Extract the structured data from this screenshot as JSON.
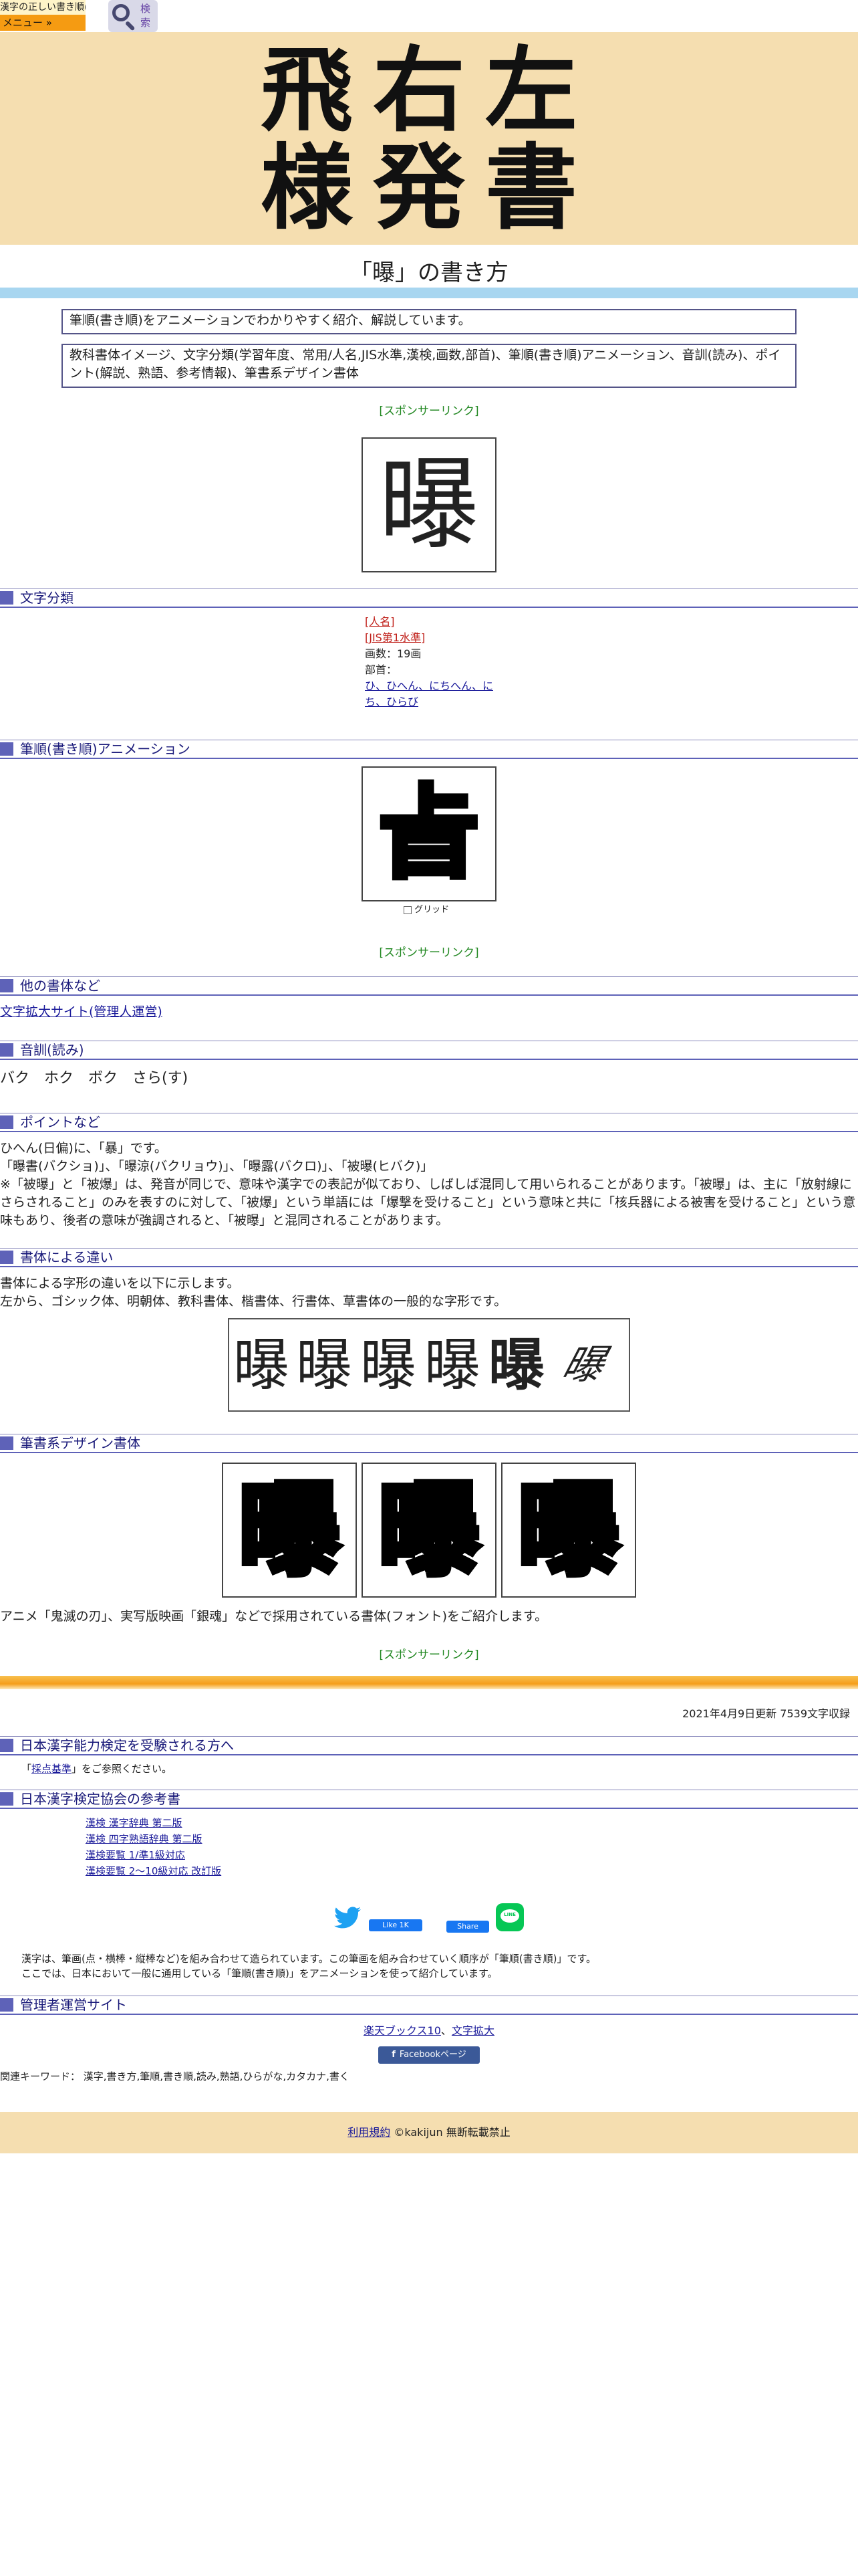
{
  "nav": {
    "logo_text": "漢字の正しい書き順(筆順)",
    "menu_label": "メニュー »",
    "search_label": "検索"
  },
  "banner": {
    "line1": "飛右左",
    "line2": "様発書"
  },
  "page_title": "「曝」の書き方",
  "intro": {
    "summary": "筆順(書き順)をアニメーションでわかりやすく紹介、解説しています。",
    "contents": "教科書体イメージ、文字分類(学習年度、常用/人名,JIS水準,漢検,画数,部首)、筆順(書き順)アニメーション、音訓(読み)、ポイント(解説、熟語、参考情報)、筆書系デザイン書体"
  },
  "sponsor_link": "[スポンサーリンク]",
  "kanji": "曝",
  "classification": {
    "heading": "文字分類",
    "jinmei": "[人名]",
    "jis": "[JIS第1水準]",
    "strokes": "画数：19画",
    "radical_label": "部首：",
    "radical": "ひ、ひへん、にちへん、にち、ひらび"
  },
  "animation": {
    "heading": "筆順(書き順)アニメーション",
    "frame_char": "㫖",
    "grid_label": "グリッド"
  },
  "other_fonts": {
    "heading": "他の書体など",
    "link": "文字拡大サイト(管理人運営)"
  },
  "readings": {
    "heading": "音訓(読み)",
    "text": "バク　ホク　ボク　さら(す)"
  },
  "points": {
    "heading": "ポイントなど",
    "line1": "ひへん(日偏)に、「暴」です。",
    "line2": "「曝書(バクショ)」、「曝涼(バクリョウ)」、「曝露(バクロ)」、「被曝(ヒバク)」",
    "line3": "※「被曝」と「被爆」は、発音が同じで、意味や漢字での表記が似ており、しばしば混同して用いられることがあります。「被曝」は、主に「放射線にさらされること」のみを表すのに対して、「被爆」という単語には「爆撃を受けること」という意味と共に「核兵器による被害を受けること」という意味もあり、後者の意味が強調されると、「被曝」と混同されることがあります。"
  },
  "font_diff": {
    "heading": "書体による違い",
    "line1": "書体による字形の違いを以下に示します。",
    "line2": "左から、ゴシック体、明朝体、教科書体、楷書体、行書体、草書体の一般的な字形です。",
    "samples": [
      "曝",
      "曝",
      "曝",
      "曝",
      "曝",
      "曝"
    ]
  },
  "design_fonts": {
    "heading": "筆書系デザイン書体",
    "chars": [
      "曝",
      "曝",
      "曝"
    ],
    "note": "アニメ「鬼滅の刃」、実写版映画「銀魂」などで採用されている書体(フォント)をご紹介します。"
  },
  "updated": "2021年4月9日更新 7539文字収録",
  "kentei": {
    "heading": "日本漢字能力検定を受験される方へ",
    "note_pre": "「",
    "note_link": "採点基準",
    "note_post": "」をご参照ください。"
  },
  "references": {
    "heading": "日本漢字検定協会の参考書",
    "items": [
      "漢検 漢字辞典 第二版",
      "漢検 四字熟語辞典 第二版",
      "漢検要覧 1/準1級対応",
      "漢検要覧 2～10級対応 改訂版"
    ]
  },
  "share": {
    "like_label": "Like 1K",
    "share_label": "Share",
    "line_label": "LINE"
  },
  "about": {
    "line1": "漢字は、筆画(点・横棒・縦棒など)を組み合わせて造られています。この筆画を組み合わせていく順序が「筆順(書き順)」です。",
    "line2": "ここでは、日本において一般に通用している「筆順(書き順)」をアニメーションを使って紹介しています。"
  },
  "admin": {
    "heading": "管理者運営サイト",
    "link1": "楽天ブックス10",
    "sep": "、",
    "link2": "文字拡大",
    "facebook": "Facebookページ"
  },
  "keywords": "関連キーワード： 漢字,書き方,筆順,書き順,読み,熟語,ひらがな,カタカナ,書く",
  "footer": {
    "terms": "利用規約",
    "copyright": "©kakijun 無断転載禁止"
  },
  "colors": {
    "banner_bg": "#f5deb0",
    "section_accent": "#5e62b8",
    "sponsor_green": "#228822",
    "menu_orange": "#f59b12"
  }
}
